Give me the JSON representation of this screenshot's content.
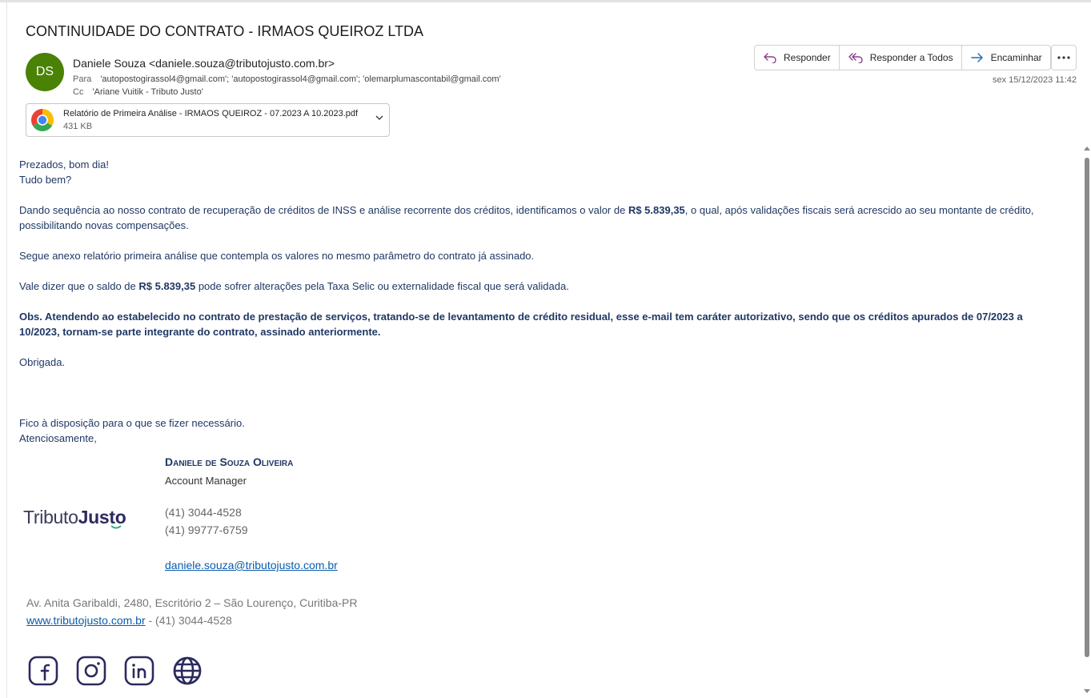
{
  "email": {
    "subject": "CONTINUIDADE DO CONTRATO - IRMAOS QUEIROZ LTDA",
    "avatar_initials": "DS",
    "avatar_color": "#498205",
    "from": "Daniele Souza <daniele.souza@tributojusto.com.br>",
    "to_label": "Para",
    "to": "'autopostogirassol4@gmail.com'; 'autopostogirassol4@gmail.com'; 'olemarplumascontabil@gmail.com'",
    "cc_label": "Cc",
    "cc": "'Ariane Vuitik - Tributo Justo'",
    "date": "sex 15/12/2023 11:42"
  },
  "actions": {
    "reply": "Responder",
    "reply_all": "Responder a Todos",
    "forward": "Encaminhar",
    "more_icon": "more-horizontal-icon"
  },
  "attachment": {
    "name": "Relatório de Primeira Análise - IRMAOS QUEIROZ - 07.2023 A 10.2023.pdf",
    "size": "431 KB",
    "icon": "chrome-icon"
  },
  "body": {
    "greeting": "Prezados, bom dia!",
    "greeting2": "Tudo bem?",
    "p1_a": "Dando sequência ao nosso contrato de recuperação de créditos de INSS e análise recorrente dos créditos, identificamos o valor de ",
    "p1_value": "R$ 5.839,35",
    "p1_b": ", o qual, após validações fiscais será acrescido ao seu montante de crédito, possibilitando novas compensações.",
    "p2": "Segue anexo relatório primeira análise que contempla os valores no mesmo parâmetro do contrato já assinado.",
    "p3_a": "Vale dizer que o saldo de ",
    "p3_value": "R$ 5.839,35",
    "p3_b": " pode sofrer alterações pela Taxa Selic ou externalidade fiscal que será validada.",
    "obs": "Obs. Atendendo ao estabelecido no contrato de prestação de serviços, tratando-se de levantamento de crédito residual, esse e-mail tem caráter autorizativo, sendo que os créditos apurados de 07/2023 a 10/2023, tornam-se parte integrante do contrato, assinado anteriormente.",
    "thanks": "Obrigada.",
    "closing1": "Fico à disposição para o que se fizer necessário.",
    "closing2": "Atenciosamente,"
  },
  "signature": {
    "name": "Daniele de Souza Oliveira",
    "role": "Account Manager",
    "logo_part1": "Tributo",
    "logo_part2": "Justo",
    "phone1": "(41) 3044-4528",
    "phone2": "(41) 99777-6759",
    "email": "daniele.souza@tributojusto.com.br",
    "address": "Av. Anita Garibaldi, 2480, Escritório 2 – São Lourenço, Curitiba-PR",
    "website": "www.tributojusto.com.br",
    "site_suffix": " - (41) 3044-4528",
    "social_icons": [
      "facebook-icon",
      "instagram-icon",
      "linkedin-icon",
      "globe-icon"
    ],
    "brand_color": "#2b2a5e",
    "accent_green": "#2bb673"
  }
}
